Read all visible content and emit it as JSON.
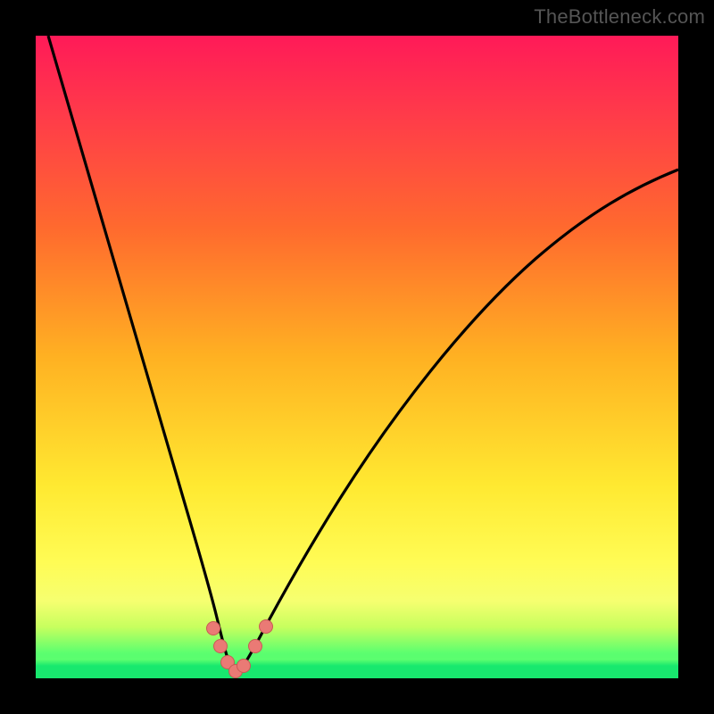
{
  "watermark": "TheBottleneck.com",
  "colors": {
    "frame": "#000000",
    "curve": "#000000",
    "dot_fill": "#ea7a75",
    "dot_stroke": "#c85a55",
    "gradient_top": "#ff1a58",
    "gradient_bottom": "#18e86e"
  },
  "chart_data": {
    "type": "line",
    "title": "",
    "xlabel": "",
    "ylabel": "",
    "xlim": [
      0,
      100
    ],
    "ylim": [
      0,
      100
    ],
    "grid": false,
    "legend_position": "none",
    "annotations": [
      "TheBottleneck.com"
    ],
    "note": "No axis ticks or labels shown; values estimated from pixel positions. y is estimated distance from bottom (0) to top (100).",
    "series": [
      {
        "name": "left-branch",
        "x": [
          2,
          5,
          8,
          11,
          14,
          17,
          20,
          22,
          24,
          25.5,
          27,
          28,
          29,
          30
        ],
        "y": [
          100,
          88,
          76,
          64,
          52,
          41,
          31,
          23,
          16,
          11,
          7,
          4.5,
          3,
          2.5
        ]
      },
      {
        "name": "right-branch",
        "x": [
          30,
          31,
          33,
          36,
          40,
          45,
          52,
          60,
          70,
          82,
          92,
          100
        ],
        "y": [
          2.5,
          3,
          5,
          9,
          15,
          23,
          33,
          44,
          55,
          66,
          73,
          79
        ]
      }
    ],
    "markers": [
      {
        "name": "dot-left-1",
        "x": 26.0,
        "y": 7.0
      },
      {
        "name": "dot-left-2",
        "x": 27.5,
        "y": 4.5
      },
      {
        "name": "dot-bottom-1",
        "x": 29.0,
        "y": 2.8
      },
      {
        "name": "dot-bottom-2",
        "x": 30.5,
        "y": 2.5
      },
      {
        "name": "dot-bottom-3",
        "x": 32.0,
        "y": 3.2
      },
      {
        "name": "dot-right-1",
        "x": 33.5,
        "y": 5.5
      },
      {
        "name": "dot-right-2",
        "x": 35.0,
        "y": 8.0
      }
    ]
  }
}
